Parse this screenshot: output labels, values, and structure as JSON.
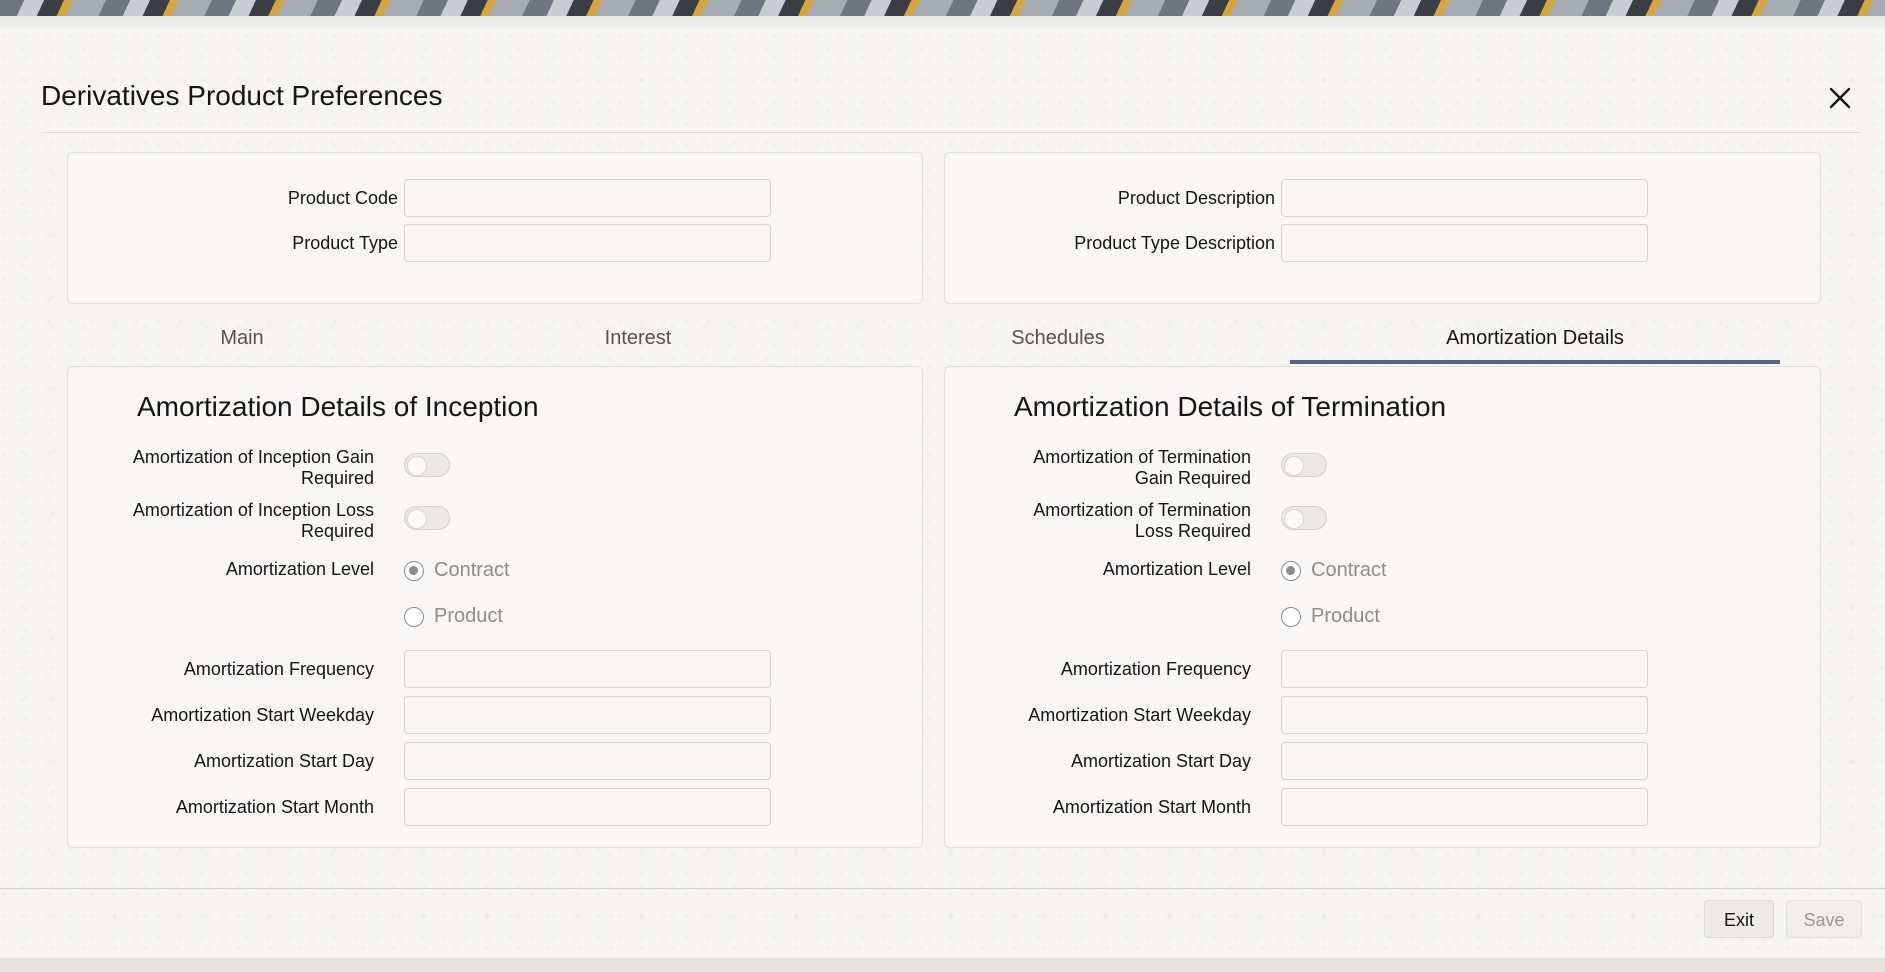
{
  "dialog": {
    "title": "Derivatives Product Preferences",
    "close_icon": "close-icon"
  },
  "header_fields": {
    "product_code": {
      "label": "Product Code",
      "value": ""
    },
    "product_type": {
      "label": "Product Type",
      "value": ""
    },
    "product_description": {
      "label": "Product Description",
      "value": ""
    },
    "product_type_description": {
      "label": "Product Type Description",
      "value": ""
    }
  },
  "tabs": [
    {
      "label": "Main",
      "active": false
    },
    {
      "label": "Interest",
      "active": false
    },
    {
      "label": "Schedules",
      "active": false
    },
    {
      "label": "Amortization Details",
      "active": true
    }
  ],
  "inception": {
    "title": "Amortization Details of Inception",
    "gain_required_label_1": "Amortization of Inception Gain",
    "gain_required_label_2": "Required",
    "loss_required_label_1": "Amortization of Inception Loss",
    "loss_required_label_2": "Required",
    "gain_required": false,
    "loss_required": false,
    "level_label": "Amortization Level",
    "level_options": [
      "Contract",
      "Product"
    ],
    "level_selected": "Contract",
    "frequency_label": "Amortization Frequency",
    "frequency_value": "",
    "start_weekday_label": "Amortization Start Weekday",
    "start_weekday_value": "",
    "start_day_label": "Amortization Start Day",
    "start_day_value": "",
    "start_month_label": "Amortization Start Month",
    "start_month_value": ""
  },
  "termination": {
    "title": "Amortization Details of Termination",
    "gain_required_label_1": "Amortization of Termination",
    "gain_required_label_2": "Gain Required",
    "loss_required_label_1": "Amortization of Termination",
    "loss_required_label_2": "Loss Required",
    "gain_required": false,
    "loss_required": false,
    "level_label": "Amortization Level",
    "level_options": [
      "Contract",
      "Product"
    ],
    "level_selected": "Contract",
    "frequency_label": "Amortization Frequency",
    "frequency_value": "",
    "start_weekday_label": "Amortization Start Weekday",
    "start_weekday_value": "",
    "start_day_label": "Amortization Start Day",
    "start_day_value": "",
    "start_month_label": "Amortization Start Month",
    "start_month_value": ""
  },
  "footer": {
    "exit_label": "Exit",
    "save_label": "Save"
  },
  "colors": {
    "active_tab_underline": "#5a6382",
    "disabled_text": "#8f8c89"
  }
}
